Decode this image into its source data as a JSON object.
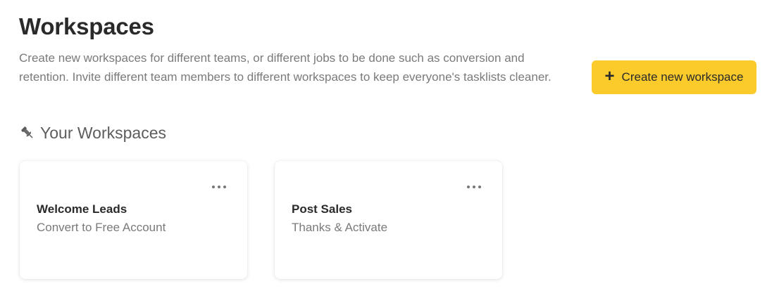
{
  "header": {
    "title": "Workspaces",
    "description": "Create new workspaces for different teams, or different jobs to be done such as conversion and retention. Invite different team members to different workspaces to keep everyone's tasklists cleaner."
  },
  "actions": {
    "create_label": "Create new workspace",
    "create_icon": "plus-icon",
    "accent_color": "#fbcb2c"
  },
  "section": {
    "title": "Your Workspaces",
    "icon": "pin-icon"
  },
  "workspaces": [
    {
      "title": "Welcome Leads",
      "subtitle": "Convert to Free Account",
      "menu_icon": "more-icon"
    },
    {
      "title": "Post Sales",
      "subtitle": "Thanks & Activate",
      "menu_icon": "more-icon"
    }
  ]
}
